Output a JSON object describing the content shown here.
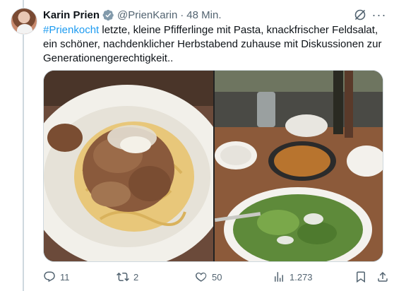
{
  "tweet": {
    "author_name": "Karin Prien",
    "handle": "@PrienKarin",
    "separator": "·",
    "time": "48 Min.",
    "hashtag": "#Prienkocht",
    "text": " letzte, kleine Pfifferlinge mit Pasta, knackfrischer Feldsalat, ein schöner, nachdenklicher Herbstabend zuhause mit Diskussionen zur Generationengerechtigkeit..",
    "more_label": "···"
  },
  "metrics": {
    "replies": "11",
    "reposts": "2",
    "likes": "50",
    "views": "1.273"
  },
  "colors": {
    "link": "#1d9bf0",
    "secondary_text": "#536471",
    "verified_badge": "#829aab",
    "thread_line": "#cfd9de"
  },
  "icons": {
    "verified": "verified-badge-icon",
    "grok": "grok-icon",
    "more": "more-icon",
    "reply": "reply-icon",
    "repost": "repost-icon",
    "like": "heart-icon",
    "views": "views-icon",
    "bookmark": "bookmark-icon",
    "share": "share-icon"
  }
}
